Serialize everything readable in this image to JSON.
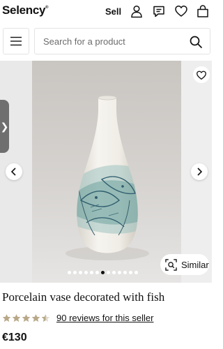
{
  "header": {
    "logo_text": "Selency",
    "logo_mark": "®",
    "sell_label": "Sell",
    "icons": [
      "account-icon",
      "messages-icon",
      "favorites-icon",
      "cart-icon"
    ]
  },
  "search": {
    "placeholder": "Search for a product",
    "menu_icon": "menu-icon",
    "search_icon": "search-icon"
  },
  "gallery": {
    "drawer_glyph": "❯",
    "prev_icon": "chevron-left-icon",
    "next_icon": "chevron-right-icon",
    "favorite_icon": "heart-icon",
    "image_count": 13,
    "active_index": 6,
    "similar_label": "Similar"
  },
  "product": {
    "title": "Porcelain vase decorated with fish",
    "rating": 4.5,
    "rating_max": 5,
    "reviews_label": "90 reviews for this seller",
    "price": "€130"
  },
  "colors": {
    "text": "#111111",
    "star": "#b8a888",
    "border": "#e3e3e3",
    "vase_glaze": "#4f8a86"
  }
}
